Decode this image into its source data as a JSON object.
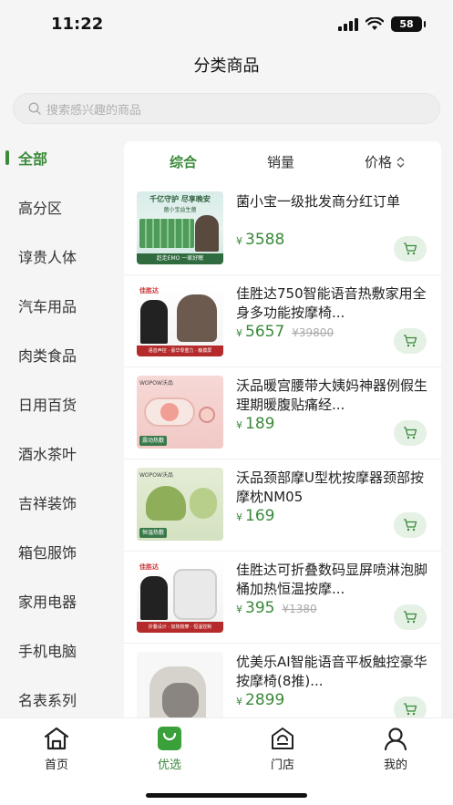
{
  "status": {
    "time": "11:22",
    "battery": "58"
  },
  "nav": {
    "title": "分类商品"
  },
  "search": {
    "placeholder": "搜索感兴趣的商品"
  },
  "categories": [
    {
      "label": "全部",
      "active": true
    },
    {
      "label": "高分区"
    },
    {
      "label": "谆贵人体"
    },
    {
      "label": "汽车用品"
    },
    {
      "label": "肉类食品"
    },
    {
      "label": "日用百货"
    },
    {
      "label": "酒水茶叶"
    },
    {
      "label": "吉祥装饰"
    },
    {
      "label": "箱包服饰"
    },
    {
      "label": "家用电器"
    },
    {
      "label": "手机电脑"
    },
    {
      "label": "名表系列"
    }
  ],
  "sort": {
    "comprehensive": "综合",
    "sales": "销量",
    "price": "价格",
    "price_icon": "sort-updown-icon"
  },
  "products": [
    {
      "title": "菌小宝一级批发商分红订单",
      "yen": "¥",
      "price": "3588",
      "old_price": "",
      "image_text": "千亿守护 尽享晚安",
      "image_text2": "菌小宝益生菌",
      "image_text3": "赶走EMO 一家好眠"
    },
    {
      "title": "佳胜达750智能语音热敷家用全身多功能按摩椅...",
      "yen": "¥",
      "price": "5657",
      "old_price": "¥39800",
      "image_text": "佳胜达",
      "image_text2": "语音声控 · 豪华零重力 · 触摸屏",
      "image_text3": ""
    },
    {
      "title": "沃品暖宫腰带大姨妈神器例假生理期暖腹贴痛经...",
      "yen": "¥",
      "price": "189",
      "old_price": "",
      "image_text": "WOPOW沃品",
      "image_text2": "震动热敷",
      "image_text3": ""
    },
    {
      "title": "沃品颈部摩U型枕按摩器颈部按摩枕NM05",
      "yen": "¥",
      "price": "169",
      "old_price": "",
      "image_text": "WOPOW沃品",
      "image_text2": "恒温热敷",
      "image_text3": ""
    },
    {
      "title": "佳胜达可折叠数码显屏喷淋泡脚桶加热恒温按摩...",
      "yen": "¥",
      "price": "395",
      "old_price": "¥1380",
      "image_text": "佳胜达",
      "image_text2": "折叠设计 · 加热按摩 · 恒温控制",
      "image_text3": ""
    },
    {
      "title": "优美乐AI智能语音平板触控豪华按摩椅(8推)...",
      "yen": "¥",
      "price": "2899",
      "old_price": "",
      "image_text": "",
      "image_text2": "",
      "image_text3": ""
    }
  ],
  "tabbar": [
    {
      "label": "首页",
      "icon": "home-icon"
    },
    {
      "label": "优选",
      "icon": "shopping-bag-icon",
      "active": true
    },
    {
      "label": "门店",
      "icon": "store-icon"
    },
    {
      "label": "我的",
      "icon": "user-icon"
    }
  ],
  "colors": {
    "accent": "#3a8a3a",
    "price": "#3a8a3a",
    "background": "#f5f5f5"
  }
}
